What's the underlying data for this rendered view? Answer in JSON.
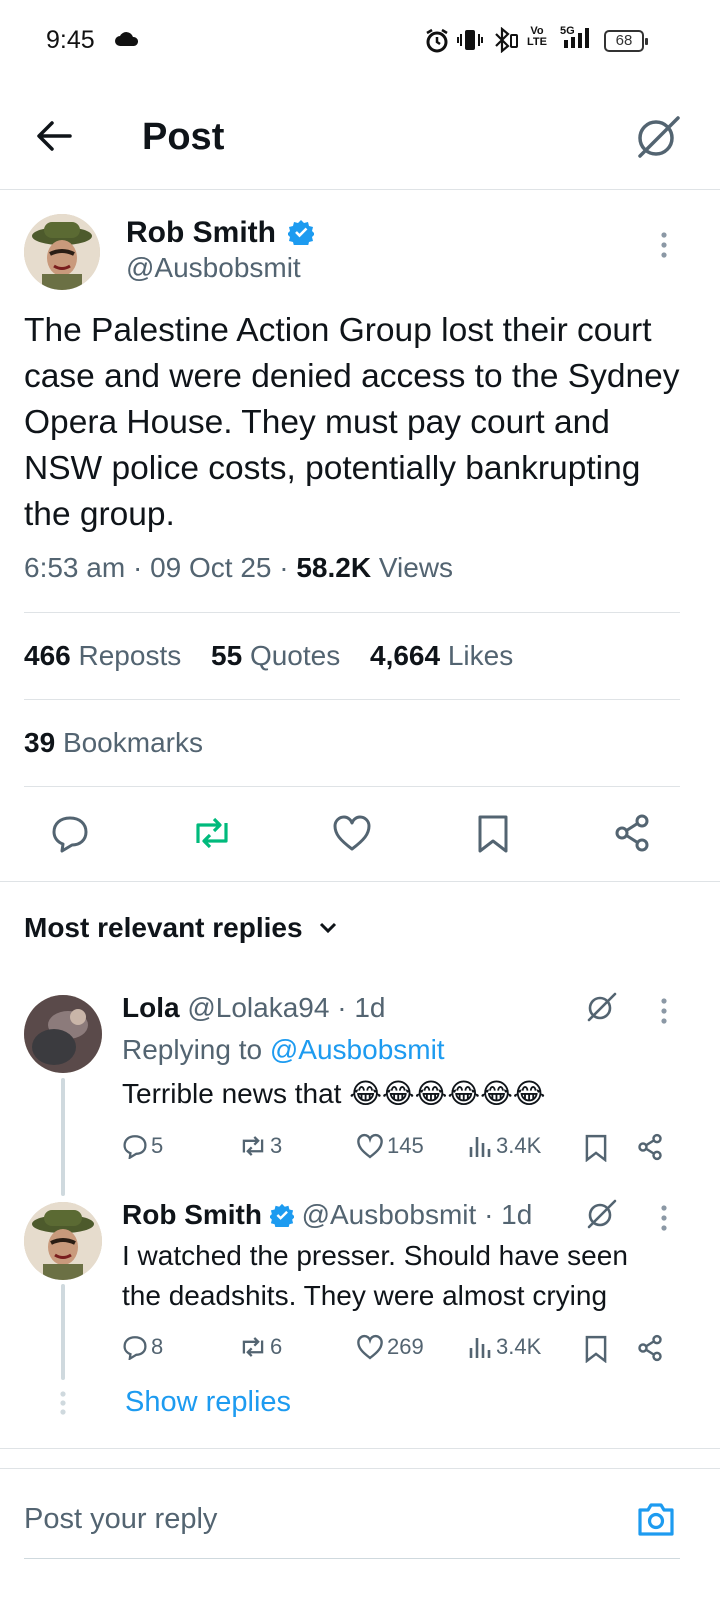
{
  "status_bar": {
    "time": "9:45",
    "battery": "68",
    "icons": [
      "cloud-icon",
      "alarm-icon",
      "vibrate-icon",
      "bluetooth-icon",
      "volte-icon",
      "5g-signal-icon",
      "battery-icon"
    ]
  },
  "header": {
    "title": "Post",
    "back_icon": "arrow-left-icon",
    "grok_icon": "grok-icon"
  },
  "post": {
    "author_name": "Rob Smith",
    "author_handle": "@Ausbobsmit",
    "verified": true,
    "body": "The Palestine Action Group lost their court case and were denied access to the Sydney Opera House. They must pay court and NSW police costs, potentially bankrupting the group.",
    "time": "6:53 am",
    "date": "09 Oct 25",
    "views_count": "58.2K",
    "views_label": "Views",
    "reposts_count": "466",
    "reposts_label": "Reposts",
    "quotes_count": "55",
    "quotes_label": "Quotes",
    "likes_count": "4,664",
    "likes_label": "Likes",
    "bookmarks_count": "39",
    "bookmarks_label": "Bookmarks"
  },
  "replies_section": {
    "sort_label": "Most relevant replies"
  },
  "replies": [
    {
      "name": "Lola",
      "handle": "@Lolaka94",
      "age": "1d",
      "replying_prefix": "Replying to",
      "replying_to": "@Ausbobsmit",
      "text": "Terrible news that 😂😂😂😂😂😂",
      "replies": "5",
      "reposts": "3",
      "likes": "145",
      "views": "3.4K"
    },
    {
      "name": "Rob Smith",
      "handle": "@Ausbobsmit",
      "age": "1d",
      "verified": true,
      "text_line1": "I watched the presser. Should have seen",
      "text_line2": "the deadshits. They were almost crying",
      "replies": "8",
      "reposts": "6",
      "likes": "269",
      "views": "3.4K"
    }
  ],
  "show_replies_label": "Show replies",
  "composer": {
    "placeholder": "Post your reply"
  },
  "colors": {
    "accent": "#1d9bf0",
    "repost_active": "#00ba7c",
    "text_primary": "#0f1419",
    "text_secondary": "#536471",
    "divider": "#dfe3e6"
  }
}
